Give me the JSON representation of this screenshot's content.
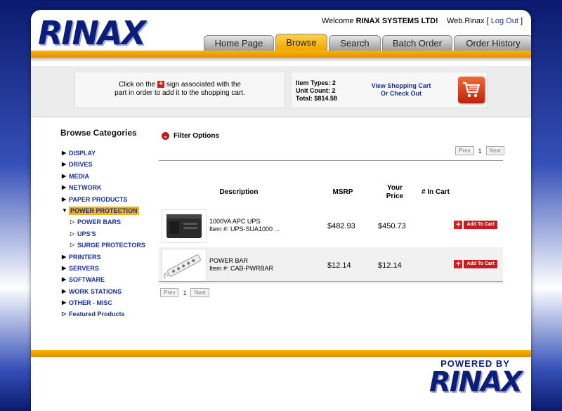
{
  "brand": {
    "logo_text": "RINAX"
  },
  "header": {
    "welcome_prefix": "Welcome",
    "company": "RINAX SYSTEMS LTD!",
    "user": "Web.Rinax",
    "bracket_open": "[",
    "logout": "Log Out",
    "bracket_close": "]"
  },
  "tabs": [
    {
      "label": "Home Page"
    },
    {
      "label": "Browse",
      "active": true
    },
    {
      "label": "Search"
    },
    {
      "label": "Batch Order"
    },
    {
      "label": "Order History"
    }
  ],
  "info": {
    "hint_line1_a": "Click on the",
    "hint_line1_b": "sign associated with the",
    "hint_line2": "part in order to add it to the shopping cart.",
    "item_types": "Item Types: 2",
    "unit_count": "Unit Count: 2",
    "total": "Total: $814.58",
    "cart_link_1": "View Shopping Cart",
    "cart_link_2": "Or Check Out",
    "cart_icon": "shopping-cart-icon"
  },
  "sidebar": {
    "title": "Browse Categories",
    "categories": [
      {
        "label": "DISPLAY"
      },
      {
        "label": "DRIVES"
      },
      {
        "label": "MEDIA"
      },
      {
        "label": "NETWORK"
      },
      {
        "label": "PAPER PRODUCTS"
      },
      {
        "label": "POWER PROTECTION",
        "active": true
      },
      {
        "label": "POWER BARS",
        "sub": true
      },
      {
        "label": "UPS'S",
        "sub": true
      },
      {
        "label": "SURGE PROTECTORS",
        "sub": true
      },
      {
        "label": "PRINTERS"
      },
      {
        "label": "SERVERS"
      },
      {
        "label": "SOFTWARE"
      },
      {
        "label": "WORK STATIONS"
      },
      {
        "label": "OTHER - MISC"
      },
      {
        "label": "Featured Products"
      }
    ]
  },
  "main": {
    "filter_label": "Filter Options",
    "pager": {
      "prev": "Prev",
      "page": "1",
      "next": "Next"
    },
    "columns": {
      "description": "Description",
      "msrp": "MSRP",
      "your_price_1": "Your",
      "your_price_2": "Price",
      "in_cart": "# In Cart"
    },
    "rows": [
      {
        "name": "1000VA APC UPS",
        "item": "Item #: UPS-SUA1000 ...",
        "msrp": "$482.93",
        "price": "$450.73",
        "add": "Add To Cart"
      },
      {
        "name": "POWER BAR",
        "item": "Item #: CAB-PWRBAR",
        "msrp": "$12.14",
        "price": "$12.14",
        "add": "Add To Cart"
      }
    ]
  },
  "footer": {
    "powered_by": "POWERED BY",
    "logo_text": "RINAX"
  },
  "colors": {
    "brand_blue": "#0b1e7a",
    "accent_gold": "#f2b31a",
    "cart_red": "#c81b1b",
    "link_blue": "#1a2fa0"
  }
}
